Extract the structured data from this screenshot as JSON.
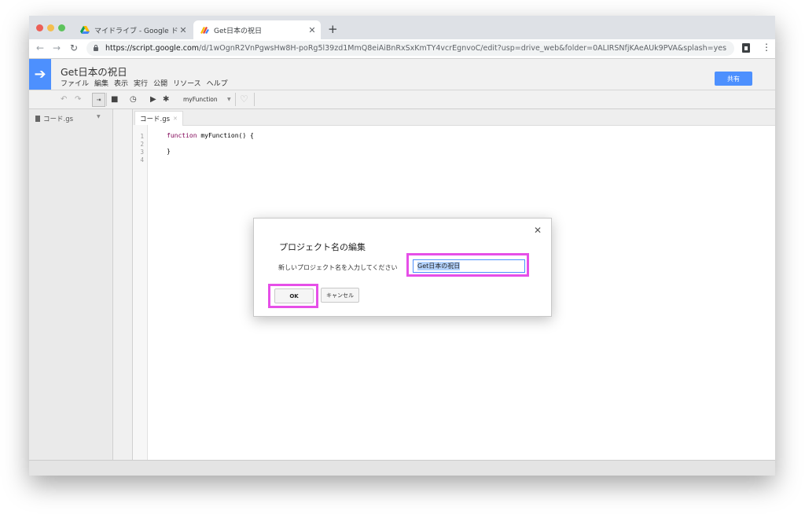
{
  "browser": {
    "tabs": [
      {
        "title": "マイドライブ - Google ドライブ",
        "icon": "google-drive-icon"
      },
      {
        "title": "Get日本の祝日",
        "icon": "apps-script-icon"
      }
    ],
    "new_tab": "+",
    "url_host": "https://script.google.com",
    "url_path": "/d/1wOgnR2VnPgwsHw8H-poRg5l39zd1MmQ8eiAiBnRxSxKmTY4vcrEgnvoC/edit?usp=drive_web&folder=0ALIRSNfjKAeAUk9PVA&splash=yes"
  },
  "header": {
    "project_title": "Get日本の祝日",
    "menus": [
      "ファイル",
      "編集",
      "表示",
      "実行",
      "公開",
      "リソース",
      "ヘルプ"
    ],
    "share_label": "共有"
  },
  "toolbar": {
    "function_name": "myFunction"
  },
  "sidebar": {
    "files": [
      {
        "name": "コード.gs"
      }
    ]
  },
  "editor": {
    "tab_name": "コード.gs",
    "line_numbers": [
      "1",
      "2",
      "3",
      "4"
    ],
    "code": {
      "line1_kw": "function",
      "line1_rest": " myFunction() {",
      "line3": "}"
    }
  },
  "dialog": {
    "title": "プロジェクト名の編集",
    "prompt": "新しいプロジェクト名を入力してください",
    "input_value": "Get日本の祝日",
    "ok_label": "OK",
    "cancel_label": "キャンセル",
    "highlight_color": "#e64fe8"
  },
  "colors": {
    "accent": "#4d90fe"
  }
}
